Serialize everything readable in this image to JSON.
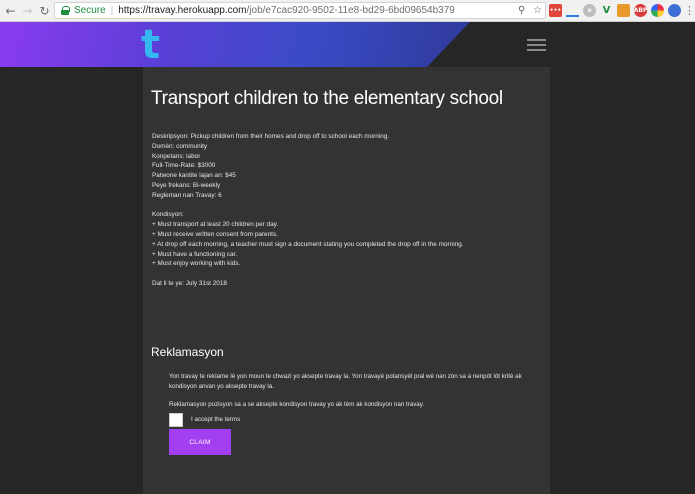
{
  "browser": {
    "secure_label": "Secure",
    "url_host": "https://travay.herokuapp.com",
    "url_path": "/job/e7cac920-9502-11e8-bd29-6bd09654b379"
  },
  "header": {
    "logo_text": "t",
    "accent_color": "#35b7f0",
    "banner_colors": [
      "#8a3cf0",
      "#3a4bc7"
    ]
  },
  "job": {
    "title": "Transport children to the elementary school",
    "description": "Deskripsyon: Pickup children from their homes and drop off to school each morning.",
    "domain": "Domèn: community",
    "competence": "Konpetans: labor",
    "full_time_rate": "Full-Time-Rate: $3000",
    "pattern_amount": "Patwone kantite lajan an: $45",
    "pay_frequency": "Peye frekans: Bi-weekly",
    "job_rule": "Regleman nan Travay: 6",
    "conditions_heading": "Kondisyon:",
    "conditions": [
      "+ Must transport at least 20 children per day.",
      "+ Must receive written consent from parents.",
      "+ At drop off each morning, a teacher must sign a document stating you completed the drop off in the morning.",
      "+ Must have a functioning car.",
      "+ Must enjoy working with kids."
    ],
    "date": "Dat li te ye: July 31st 2018"
  },
  "claim": {
    "heading": "Reklamasyon",
    "text1": "Yon travay te reklame lè yon moun te chwazi yo aksepte travay la. Yon travayè potansyèl pral wè nan zòn sa a nenpòt lòt kritè ak kondisyon anvan yo aksepte travay la.",
    "text2": "Reklamasyon pozisyon sa a se aksepte kondisyon travay yo ak tèm ak kondisyon nan travay.",
    "terms_label": "I accept the terms",
    "terms_checked": false,
    "button_label": "CLAIM",
    "button_color": "#a23ff0"
  }
}
